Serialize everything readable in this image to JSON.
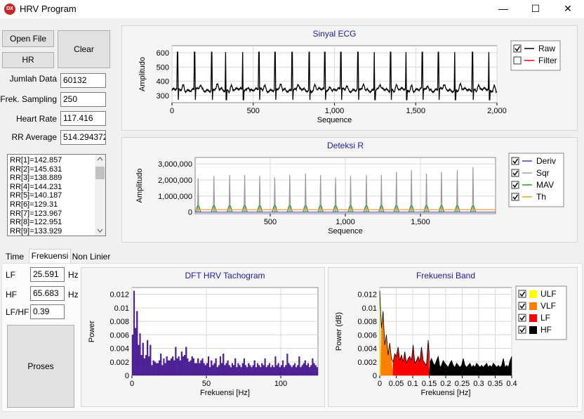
{
  "window": {
    "title": "HRV Program",
    "icon_text": "DX",
    "minimize": "—",
    "maximize": "☐",
    "close": "✕"
  },
  "left": {
    "open_file": "Open File",
    "clear": "Clear",
    "hr_button": "HR",
    "fields": [
      {
        "label": "Jumlah Data",
        "value": "60132"
      },
      {
        "label": "Frek. Sampling",
        "value": "250"
      },
      {
        "label": "Heart Rate",
        "value": "117.416"
      },
      {
        "label": "RR Average",
        "value": "514.294372"
      }
    ],
    "rr_list": [
      "RR[1]=142.857",
      "RR[2]=145.631",
      "RR[3]=138.889",
      "RR[4]=144.231",
      "RR[5]=140.187",
      "RR[6]=129.31",
      "RR[7]=123.967",
      "RR[8]=122.951",
      "RR[9]=133.929"
    ]
  },
  "tabs": [
    "Time",
    "Frekuensi",
    "Non Linier"
  ],
  "freq": {
    "lf_label": "LF",
    "lf_value": "25.591",
    "lf_unit": "Hz",
    "hf_label": "HF",
    "hf_value": "65.683",
    "hf_unit": "Hz",
    "ratio_label": "LF/HF",
    "ratio_value": "0.39",
    "proses": "Proses"
  },
  "chart_data": [
    {
      "type": "line",
      "title": "Sinyal ECG",
      "xlabel": "Sequence",
      "ylabel": "Amplitudo",
      "xlim": [
        0,
        2000
      ],
      "ylim": [
        250,
        650
      ],
      "xticks": [
        "0",
        "500",
        "1,000",
        "1,500",
        "2,000"
      ],
      "yticks": [
        "300",
        "400",
        "500",
        "600"
      ],
      "grid": true,
      "legend_placement": "right",
      "series": [
        {
          "name": "Raw",
          "color": "#000000"
        },
        {
          "name": "Filter",
          "color": "#ff0000"
        }
      ],
      "legend_checked": [
        true,
        false
      ],
      "r_peak_positions": [
        35,
        140,
        245,
        330,
        435,
        535,
        635,
        740,
        845,
        940,
        1040,
        1145,
        1245,
        1345,
        1440,
        1540,
        1640,
        1740,
        1850,
        1950
      ],
      "r_peak_value": 605,
      "baseline": 340,
      "trough": 270
    },
    {
      "type": "line",
      "title": "Deteksi R",
      "xlabel": "Sequence",
      "ylabel": "Amplitudo",
      "xlim": [
        0,
        2000
      ],
      "ylim": [
        -100000,
        3400000
      ],
      "xticks": [
        "500",
        "1,000",
        "1,500"
      ],
      "yticks": [
        "0",
        "1,000,000",
        "2,000,000",
        "3,000,000"
      ],
      "grid": true,
      "legend_placement": "right",
      "series": [
        {
          "name": "Deriv",
          "color": "#4040c0"
        },
        {
          "name": "Sqr",
          "color": "#a0a0a0"
        },
        {
          "name": "MAV",
          "color": "#20a020"
        },
        {
          "name": "Th",
          "color": "#f0a030"
        }
      ],
      "legend_checked": [
        true,
        true,
        true,
        true
      ],
      "peaks": [
        2100000,
        2250000,
        2300000,
        2300000,
        2250000,
        2150000,
        2300000,
        2400000,
        2300000,
        2150000,
        2250000,
        2300000,
        2300000,
        2500000,
        2600000,
        2400000,
        2500000,
        2600000,
        2800000
      ],
      "peak_positions": [
        20,
        125,
        230,
        330,
        430,
        530,
        630,
        735,
        835,
        935,
        1035,
        1140,
        1240,
        1340,
        1440,
        1540,
        1640,
        1745,
        1850
      ],
      "mav_peak": 500000,
      "th_value": 150000
    },
    {
      "type": "bar",
      "title": "DFT HRV Tachogram",
      "xlabel": "Frekuensi [Hz]",
      "ylabel": "Power",
      "xlim": [
        0,
        125
      ],
      "ylim": [
        0,
        0.013
      ],
      "xticks": [
        "0",
        "50",
        "100"
      ],
      "yticks": [
        "0",
        "0.002",
        "0.004",
        "0.006",
        "0.008",
        "0.01",
        "0.012"
      ],
      "grid": true,
      "color": "#5020a0",
      "values": [
        0.006,
        0.0125,
        0.007,
        0.0095,
        0.0045,
        0.0062,
        0.003,
        0.0048,
        0.0025,
        0.003,
        0.0052,
        0.0028,
        0.0045,
        0.0015,
        0.0022,
        0.002,
        0.0018,
        0.0018,
        0.0022,
        0.0032,
        0.0015,
        0.0025,
        0.0018,
        0.0028,
        0.0022,
        0.0022,
        0.0025,
        0.0028,
        0.0022,
        0.0042,
        0.0025,
        0.0028,
        0.0022,
        0.0035,
        0.0028,
        0.003,
        0.0042,
        0.0025,
        0.002,
        0.0022,
        0.0028,
        0.0025,
        0.0018,
        0.0018,
        0.0025,
        0.0018,
        0.0022,
        0.0025,
        0.0018,
        0.0015,
        0.0018,
        0.0028,
        0.0012,
        0.0022,
        0.0015,
        0.0018,
        0.0025,
        0.0012,
        0.0015,
        0.0028,
        0.0018,
        0.0032,
        0.0015,
        0.0018,
        0.0022,
        0.0015,
        0.0012,
        0.0018,
        0.0015,
        0.0025,
        0.0012,
        0.0018,
        0.0015,
        0.0012,
        0.0018,
        0.0025,
        0.0015,
        0.0012,
        0.0018,
        0.0015,
        0.0012,
        0.0015,
        0.0022,
        0.0012,
        0.0018,
        0.0015,
        0.0012,
        0.0018,
        0.0015,
        0.0025,
        0.0012,
        0.0015,
        0.0018,
        0.0012,
        0.0015,
        0.0012,
        0.0028,
        0.0015,
        0.0018,
        0.0012,
        0.0015,
        0.0022,
        0.0012,
        0.0015,
        0.0032,
        0.0018,
        0.0015,
        0.0012,
        0.0015,
        0.0018,
        0.0012,
        0.0015,
        0.0028,
        0.0012,
        0.0015,
        0.0018,
        0.0022,
        0.0015,
        0.0018,
        0.0012,
        0.0015,
        0.0025,
        0.0018,
        0.0015,
        0.0012
      ]
    },
    {
      "type": "area",
      "title": "Frekuensi Band",
      "xlabel": "Frekuensi [Hz]",
      "ylabel": "Power (dB)",
      "xlim": [
        0,
        0.4
      ],
      "ylim": [
        0,
        0.013
      ],
      "xticks": [
        "0",
        "0.05",
        "0.1",
        "0.15",
        "0.2",
        "0.25",
        "0.3",
        "0.35",
        "0.4"
      ],
      "yticks": [
        "0",
        "0.002",
        "0.004",
        "0.006",
        "0.008",
        "0.01",
        "0.012"
      ],
      "grid": true,
      "legend_placement": "right",
      "series": [
        {
          "name": "ULF",
          "color": "#ffff00",
          "range": [
            0,
            0.003
          ]
        },
        {
          "name": "VLF",
          "color": "#ff8000",
          "range": [
            0.003,
            0.04
          ]
        },
        {
          "name": "LF",
          "color": "#ff0000",
          "range": [
            0.04,
            0.15
          ]
        },
        {
          "name": "HF",
          "color": "#000000",
          "range": [
            0.15,
            0.4
          ]
        }
      ],
      "legend_checked": [
        true,
        true,
        true,
        true
      ],
      "values": [
        0.0125,
        0.007,
        0.0095,
        0.0045,
        0.006,
        0.003,
        0.0048,
        0.0025,
        0.002,
        0.0032,
        0.0028,
        0.0042,
        0.0022,
        0.003,
        0.002,
        0.0035,
        0.0018,
        0.0025,
        0.0028,
        0.0022,
        0.0045,
        0.0018,
        0.0022,
        0.0028,
        0.002,
        0.0042,
        0.0022,
        0.0018,
        0.0015,
        0.0052,
        0.0018,
        0.0025,
        0.0018,
        0.0015,
        0.0022,
        0.0028,
        0.0012,
        0.0015,
        0.0022,
        0.0018,
        0.0015,
        0.0012,
        0.0018,
        0.0022,
        0.0015,
        0.0012,
        0.0018,
        0.0015,
        0.0012,
        0.0015,
        0.0025,
        0.0015,
        0.0012,
        0.0015,
        0.0018,
        0.0012,
        0.0015,
        0.0012,
        0.0018,
        0.0015,
        0.0012,
        0.0015,
        0.0012,
        0.0015,
        0.0018,
        0.0012,
        0.0015,
        0.0012,
        0.0018,
        0.0015,
        0.0012,
        0.0015,
        0.0012,
        0.0015,
        0.0025,
        0.0012,
        0.0015,
        0.0012,
        0.0022,
        0.0028
      ]
    }
  ]
}
